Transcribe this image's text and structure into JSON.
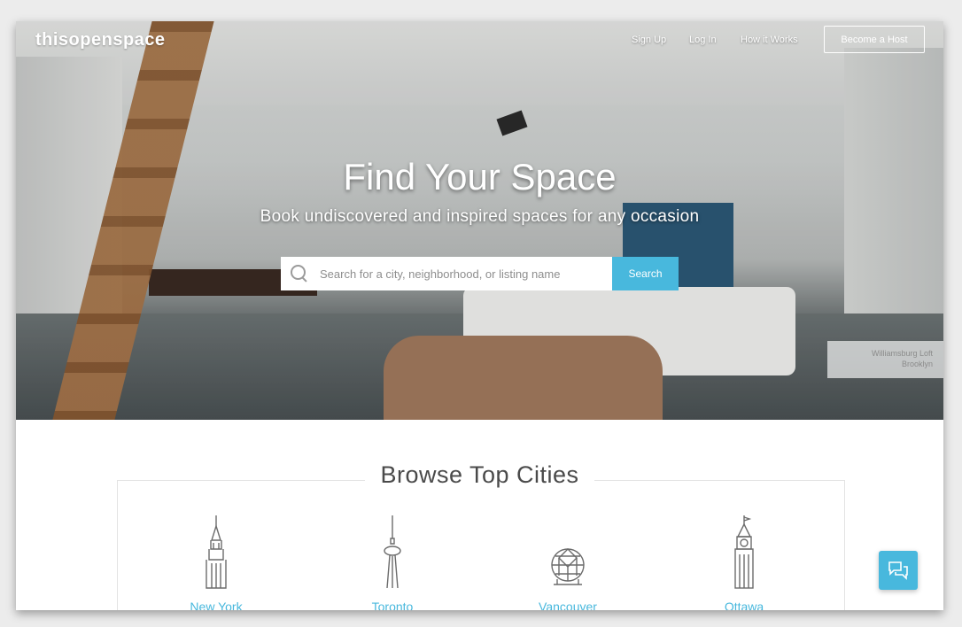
{
  "header": {
    "logo": "thisopenspace",
    "nav": [
      "Sign Up",
      "Log In",
      "How it Works"
    ],
    "host_button": "Become a Host"
  },
  "hero": {
    "title": "Find Your Space",
    "subtitle": "Book undiscovered and inspired spaces for any occasion",
    "search_placeholder": "Search for a city, neighborhood, or listing name",
    "search_button": "Search",
    "photo_caption_line1": "Williamsburg Loft",
    "photo_caption_line2": "Brooklyn"
  },
  "browse": {
    "title": "Browse Top Cities",
    "cities": [
      {
        "name": "New York",
        "icon": "chrysler-building-icon"
      },
      {
        "name": "Toronto",
        "icon": "cn-tower-icon"
      },
      {
        "name": "Vancouver",
        "icon": "science-world-dome-icon"
      },
      {
        "name": "Ottawa",
        "icon": "peace-tower-icon"
      }
    ]
  },
  "chat": {
    "icon": "chat-bubbles-icon"
  },
  "colors": {
    "accent": "#48b8dd",
    "text_dark": "#4a4a4a"
  }
}
